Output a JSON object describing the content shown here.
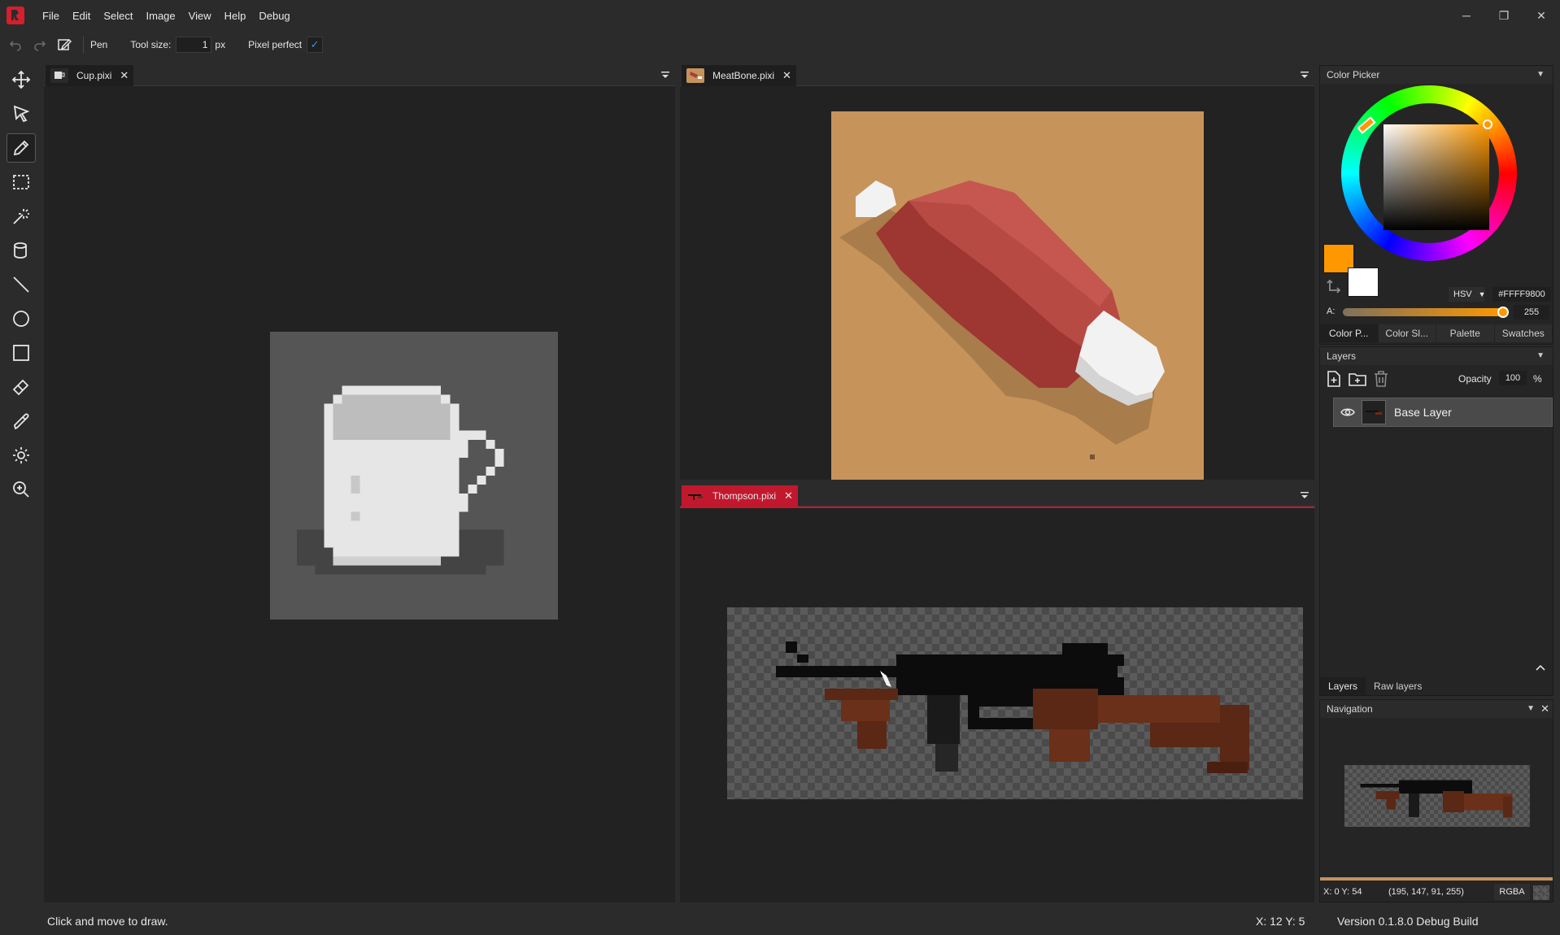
{
  "menu": [
    "File",
    "Edit",
    "Select",
    "Image",
    "View",
    "Help",
    "Debug"
  ],
  "window_controls": {
    "minimize": "─",
    "restore": "❐",
    "close": "✕"
  },
  "toolbar": {
    "tool_name": "Pen",
    "tool_size_label": "Tool size:",
    "tool_size_value": "1",
    "tool_size_unit": "px",
    "pixel_perfect_label": "Pixel perfect",
    "pixel_perfect_check": "✓"
  },
  "tools": [
    "move-tool",
    "select-tool",
    "pen-tool",
    "rectangle-select-tool",
    "magic-wand-tool",
    "bucket-tool",
    "line-tool",
    "ellipse-tool",
    "rectangle-tool",
    "eraser-tool",
    "color-picker-tool",
    "brightness-tool",
    "zoom-tool"
  ],
  "documents": {
    "cup": {
      "title": "Cup.pixi",
      "close": "✕"
    },
    "meatbone": {
      "title": "MeatBone.pixi",
      "close": "✕"
    },
    "thompson": {
      "title": "Thompson.pixi",
      "close": "✕"
    }
  },
  "color_picker": {
    "title": "Color Picker",
    "primary_color": "#FF9800",
    "secondary_color": "#FFFFFF",
    "mode": "HSV",
    "hex_value": "#FFFF9800",
    "alpha_label": "A:",
    "alpha_value": "255",
    "tabs": [
      "Color P...",
      "Color Sl...",
      "Palette",
      "Swatches"
    ]
  },
  "layers": {
    "title": "Layers",
    "opacity_label": "Opacity",
    "opacity_value": "100",
    "opacity_unit": "%",
    "items": [
      {
        "name": "Base Layer"
      }
    ],
    "bottom_tabs": [
      "Layers",
      "Raw layers"
    ]
  },
  "navigation": {
    "title": "Navigation",
    "pixel_info": "X: 0 Y: 54",
    "pixel_rgba": "(195, 147, 91, 255)",
    "mode_button": "RGBA"
  },
  "status": {
    "message": "Click and move to draw.",
    "coords": "X: 12  Y: 5",
    "version": "Version 0.1.8.0 Debug Build"
  },
  "colors": {
    "accent": "#c2182e",
    "background": "#2b2b2b",
    "canvas_bg": "#222222"
  }
}
